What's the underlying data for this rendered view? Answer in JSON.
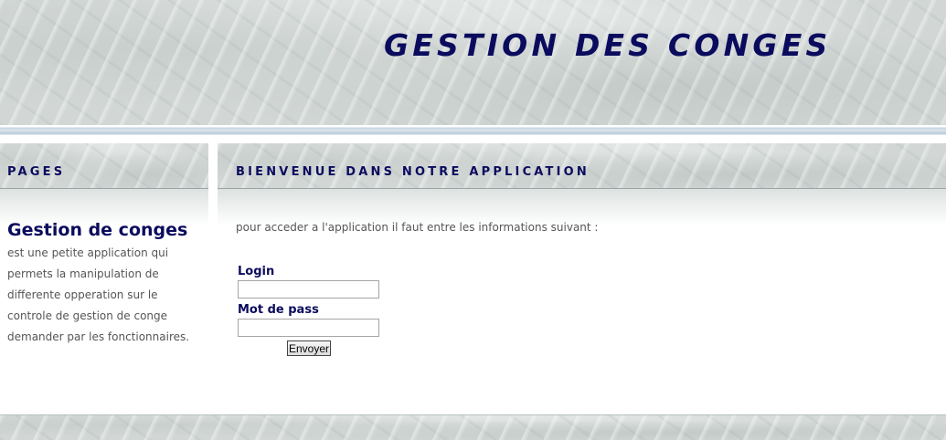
{
  "header": {
    "title": "GESTION DES CONGES"
  },
  "sidebar": {
    "heading": "PAGES",
    "title": "Gestion de conges",
    "description": "est une petite application qui permets la manipulation de differente opperation sur le controle de gestion de conge demander par les fonctionnaires."
  },
  "main": {
    "heading": "BIENVENUE DANS NOTRE APPLICATION",
    "intro": "pour acceder a l'application il faut entre les informations suivant :",
    "form": {
      "login_label": "Login",
      "login_value": "",
      "password_label": "Mot de pass",
      "password_value": "",
      "submit_label": "Envoyer"
    }
  },
  "colors": {
    "heading_navy": "#0b0b5e",
    "body_text": "#555555",
    "marble": "#d2d7d5"
  }
}
